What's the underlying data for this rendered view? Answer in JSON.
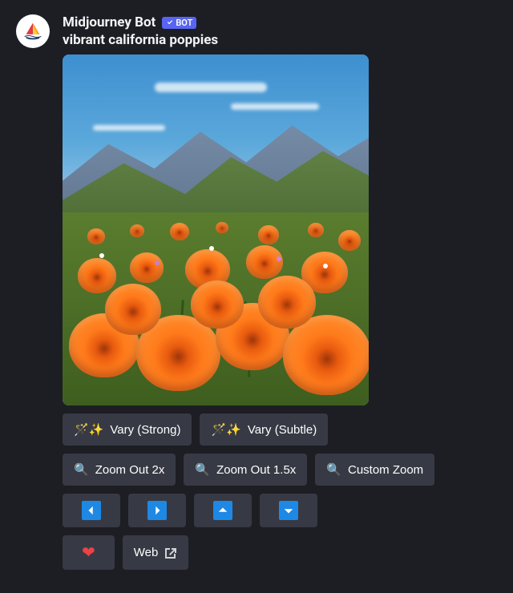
{
  "author": "Midjourney Bot",
  "badge": {
    "label": "BOT"
  },
  "prompt": "vibrant california poppies",
  "buttons": {
    "vary_strong": "Vary (Strong)",
    "vary_subtle": "Vary (Subtle)",
    "zoom_2x": "Zoom Out 2x",
    "zoom_15x": "Zoom Out 1.5x",
    "custom_zoom": "Custom Zoom",
    "web": "Web"
  },
  "icons": {
    "wand": "🪄",
    "magnifier": "🔍",
    "heart": "❤"
  }
}
